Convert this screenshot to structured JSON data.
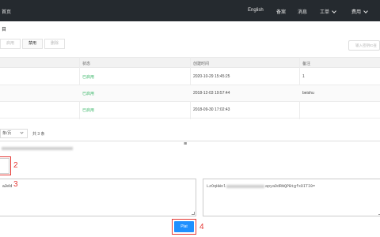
{
  "header": {
    "brand": "首页",
    "nav": [
      {
        "label": "English"
      },
      {
        "label": "备案"
      },
      {
        "label": "消息"
      },
      {
        "label": "工单"
      },
      {
        "label": "费用"
      }
    ]
  },
  "breadcrumb": "目",
  "tabs": [
    {
      "label": "启用"
    },
    {
      "label": "禁用"
    },
    {
      "label": "删除"
    }
  ],
  "search": {
    "placeholder": "输入密钥ID查"
  },
  "table": {
    "headers": [
      "状态",
      "创建时间",
      "备注"
    ],
    "rows": [
      {
        "status": "已启用",
        "created": "2020-10-29 15:45:25",
        "note": "1"
      },
      {
        "status": "已启用",
        "created": "2018-12-03 19:57:44",
        "note": "beishu"
      },
      {
        "status": "已启用",
        "created": "2018-09-30 17:02:43",
        "note": ""
      }
    ]
  },
  "pagination": {
    "page_size": "条/页",
    "total": "共 3 条"
  },
  "panel": {
    "left_text": "aJeId",
    "right_text_start": "LzOqHWol",
    "right_text_end": "apyaDdRNQPBtgfxDITI0=",
    "action_label": "Plat"
  },
  "annotations": [
    "2",
    "3",
    "4"
  ],
  "colors": {
    "topbar": "#252a2f",
    "status_green": "#3db86b",
    "primary": "#1e90ff",
    "annotation_red": "#e53935"
  }
}
